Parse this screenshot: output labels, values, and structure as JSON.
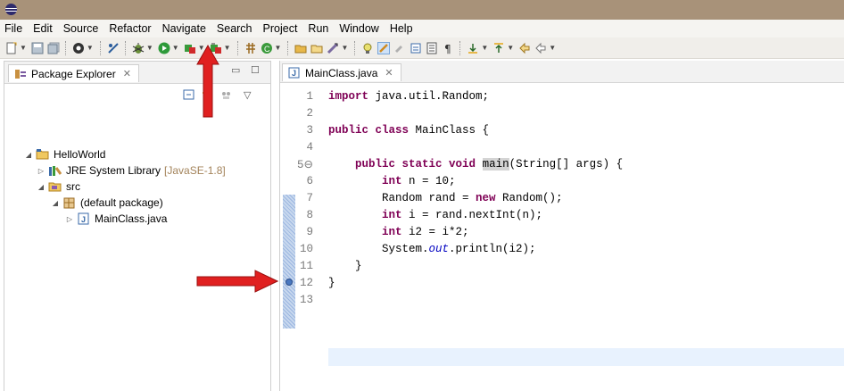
{
  "menu": [
    "File",
    "Edit",
    "Source",
    "Refactor",
    "Navigate",
    "Search",
    "Project",
    "Run",
    "Window",
    "Help"
  ],
  "toolbar_icons": [
    "new-icon",
    "save-icon",
    "save-all-icon",
    "console-icon",
    "skip-breakpoints-icon",
    "debug-icon",
    "run-icon",
    "coverage-icon",
    "external-tools-icon",
    "new-java-project-icon",
    "new-class-icon",
    "open-type-icon",
    "open-task-icon",
    "search-icon",
    "annotation-icon",
    "java-editor-icon",
    "highlight-icon",
    "toggle-icon",
    "show-whitespace-icon",
    "next-annotation-icon",
    "prev-annotation-icon",
    "back-icon",
    "forward-icon"
  ],
  "left_panel": {
    "tab_label": "Package Explorer",
    "tab_close": "✕",
    "tree": {
      "project": "HelloWorld",
      "jre": "JRE System Library",
      "jre_decor": "[JavaSE-1.8]",
      "src": "src",
      "package": "(default package)",
      "file": "MainClass.java"
    }
  },
  "editor": {
    "tab_label": "MainClass.java",
    "tab_close": "✕",
    "lines": [
      {
        "n": "1",
        "code": "import java.util.Random;"
      },
      {
        "n": "2",
        "code": ""
      },
      {
        "n": "3",
        "code": "public class MainClass {"
      },
      {
        "n": "4",
        "code": ""
      },
      {
        "n": "5⊖",
        "code": "    public static void main(String[] args) {"
      },
      {
        "n": "6",
        "code": "        int n = 10;"
      },
      {
        "n": "7",
        "code": "        Random rand = new Random();"
      },
      {
        "n": "8",
        "code": "        int i = rand.nextInt(n);"
      },
      {
        "n": "9",
        "code": "        int i2 = i*2;"
      },
      {
        "n": "10",
        "code": "        System.out.println(i2);"
      },
      {
        "n": "11",
        "code": "    }"
      },
      {
        "n": "12",
        "code": "}"
      },
      {
        "n": "13",
        "code": ""
      }
    ]
  },
  "colors": {
    "titlebar": "#a89279",
    "keyword": "#7f0055",
    "field": "#0000c0",
    "arrow": "#e02020",
    "current_line": "#e8f2fe"
  }
}
